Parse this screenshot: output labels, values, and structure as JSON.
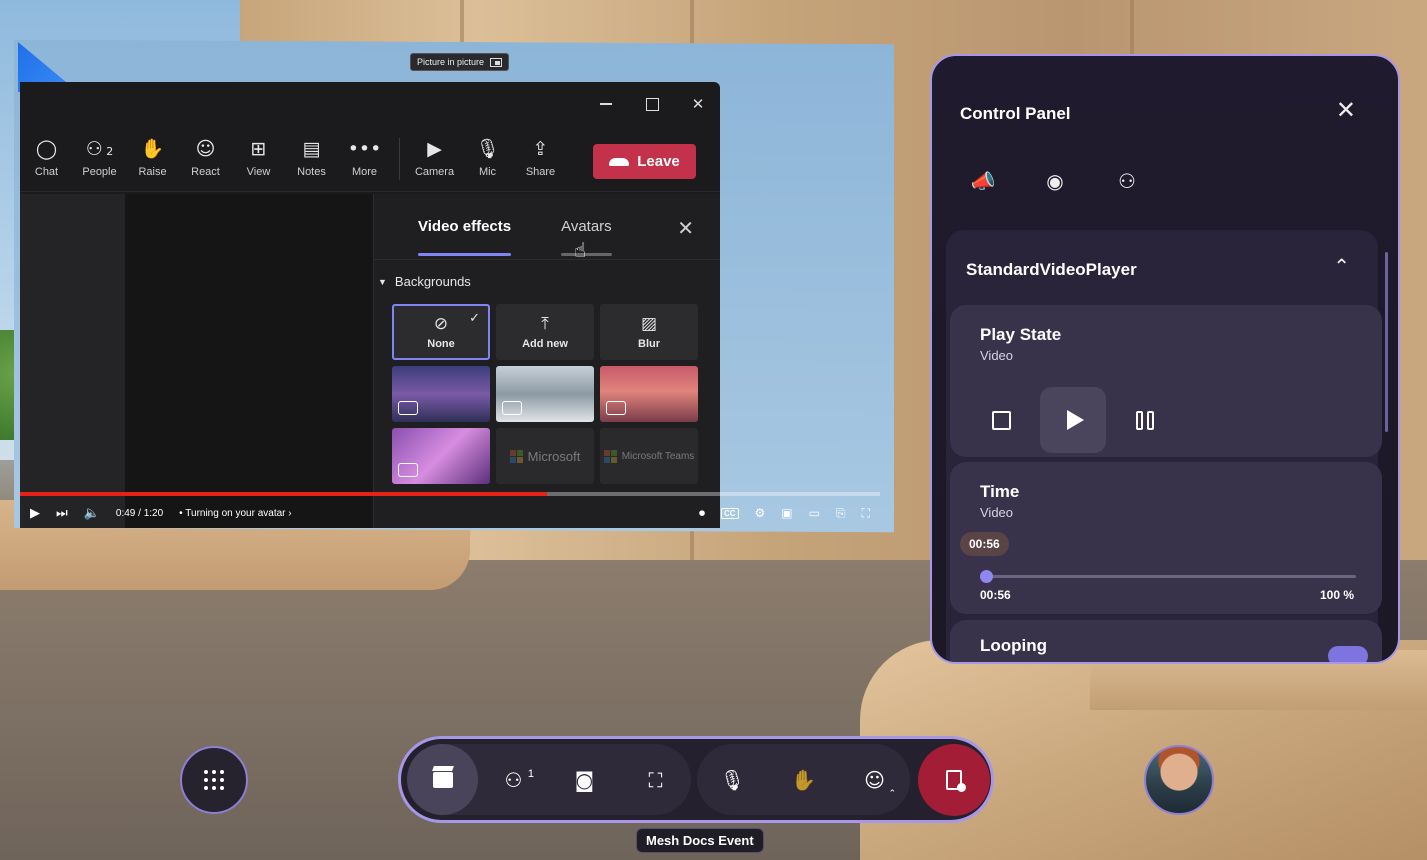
{
  "pip_tooltip": "Picture in picture",
  "teams": {
    "toolbar": [
      {
        "label": "Chat",
        "icon": "chat-icon",
        "glyph": "◯"
      },
      {
        "label": "People",
        "icon": "people-icon",
        "glyph": "⚇",
        "badge": "2"
      },
      {
        "label": "Raise",
        "icon": "raise-hand-icon",
        "glyph": "✋"
      },
      {
        "label": "React",
        "icon": "react-icon",
        "glyph": "☺"
      },
      {
        "label": "View",
        "icon": "view-icon",
        "glyph": "⊞"
      },
      {
        "label": "Notes",
        "icon": "notes-icon",
        "glyph": "▤"
      },
      {
        "label": "More",
        "icon": "more-icon",
        "glyph": "•••"
      },
      {
        "label": "Camera",
        "icon": "camera-off-icon",
        "glyph": "▶"
      },
      {
        "label": "Mic",
        "icon": "mic-icon",
        "glyph": "🎙"
      },
      {
        "label": "Share",
        "icon": "share-icon",
        "glyph": "⇪"
      }
    ],
    "leave_label": "Leave",
    "effects": {
      "tabs": [
        "Video effects",
        "Avatars"
      ],
      "active_tab": "Video effects",
      "backgrounds_heading": "Backgrounds",
      "options": [
        {
          "label": "None",
          "glyph": "⊘",
          "selected": true
        },
        {
          "label": "Add new",
          "glyph": "⤒"
        },
        {
          "label": "Blur",
          "glyph": "▨"
        }
      ],
      "logo_tiles": [
        "Microsoft",
        "Microsoft Teams"
      ]
    }
  },
  "youtube": {
    "time": "0:49 / 1:20",
    "chapter": "Turning on your avatar",
    "cc_label": "CC",
    "progress": 0.6125
  },
  "control_panel": {
    "title": "Control Panel",
    "section_title": "StandardVideoPlayer",
    "play_state": {
      "title": "Play State",
      "subtitle": "Video"
    },
    "time": {
      "title": "Time",
      "subtitle": "Video",
      "current": "00:56",
      "start_label": "00:56",
      "end_label": "100 %",
      "fraction": 0.0
    },
    "looping": {
      "title": "Looping"
    }
  },
  "dock": {
    "people_count": "1",
    "event_name": "Mesh Docs Event"
  },
  "colors": {
    "accent": "#a797e6",
    "leave": "#c4314b",
    "dock_leave": "#a41d37",
    "slider": "#8f86f0"
  }
}
